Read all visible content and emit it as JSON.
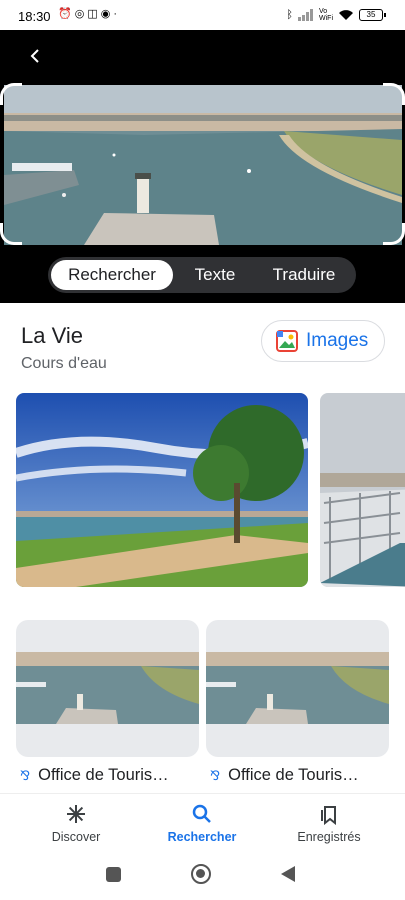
{
  "status_bar": {
    "time": "18:30",
    "battery": "35",
    "network": "Vo WiFi"
  },
  "lens": {
    "tabs": [
      {
        "label": "Rechercher",
        "active": true
      },
      {
        "label": "Texte",
        "active": false
      },
      {
        "label": "Traduire",
        "active": false
      }
    ]
  },
  "result": {
    "title": "La Vie",
    "subtitle": "Cours d'eau",
    "images_button": "Images"
  },
  "cards": [
    {
      "source": "Office de Touris…"
    },
    {
      "source": "Office de Touris…"
    }
  ],
  "bottom_nav": [
    {
      "label": "Discover",
      "icon": "asterisk-icon",
      "active": false
    },
    {
      "label": "Rechercher",
      "icon": "search-icon",
      "active": true
    },
    {
      "label": "Enregistrés",
      "icon": "bookmarks-icon",
      "active": false
    }
  ],
  "colors": {
    "accent": "#1a73e8",
    "dark": "#000000",
    "pill": "#303134"
  }
}
